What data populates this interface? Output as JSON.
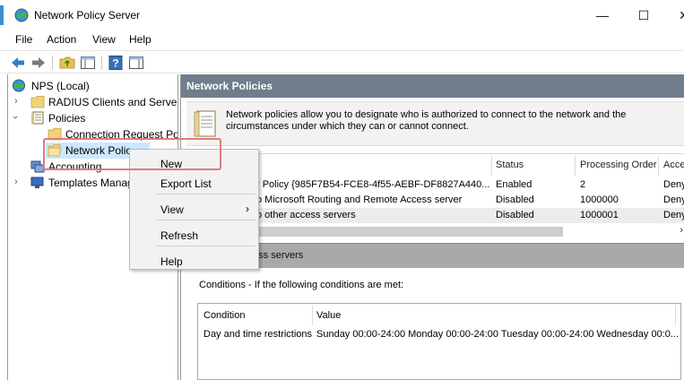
{
  "window": {
    "title": "Network Policy Server",
    "minimize_glyph": "—",
    "maximize_glyph": "☐",
    "close_glyph": "✕"
  },
  "menubar": [
    "File",
    "Action",
    "View",
    "Help"
  ],
  "tree": {
    "root": "NPS (Local)",
    "radius": "RADIUS Clients and Servers",
    "policies": "Policies",
    "connection_request": "Connection Request Po",
    "network_policies": "Network Polic",
    "accounting": "Accounting",
    "templates": "Templates Manag"
  },
  "panel": {
    "header": "Network Policies",
    "description": "Network policies allow you to designate who is authorized to connect to the network and the circumstances under which they can or cannot connect."
  },
  "list": {
    "columns": [
      "Status",
      "Processing Order",
      "Acce"
    ],
    "rows": [
      {
        "name": "r Policy {985F7B54-FCE8-4f55-AEBF-DF8827A440...",
        "status": "Enabled",
        "order": "2",
        "access": "Deny"
      },
      {
        "name": "o Microsoft Routing and Remote Access server",
        "status": "Disabled",
        "order": "1000000",
        "access": "Deny"
      },
      {
        "name": "o other access servers",
        "status": "Disabled",
        "order": "1000001",
        "access": "Deny"
      }
    ]
  },
  "detail": {
    "title": "s to other access servers",
    "conditions_label": "Conditions - If the following conditions are met:",
    "columns": [
      "Condition",
      "Value"
    ],
    "row": {
      "condition": "Day and time restrictions",
      "value": "Sunday 00:00-24:00 Monday 00:00-24:00 Tuesday 00:00-24:00 Wednesday 00:0..."
    }
  },
  "context_menu": {
    "new": "New",
    "export": "Export List",
    "view": "View",
    "view_arrow": "›",
    "refresh": "Refresh",
    "help": "Help"
  },
  "colors": {
    "header_bg": "#6f7d8c",
    "highlight": "#e07b7b",
    "selection": "#cce8ff"
  }
}
